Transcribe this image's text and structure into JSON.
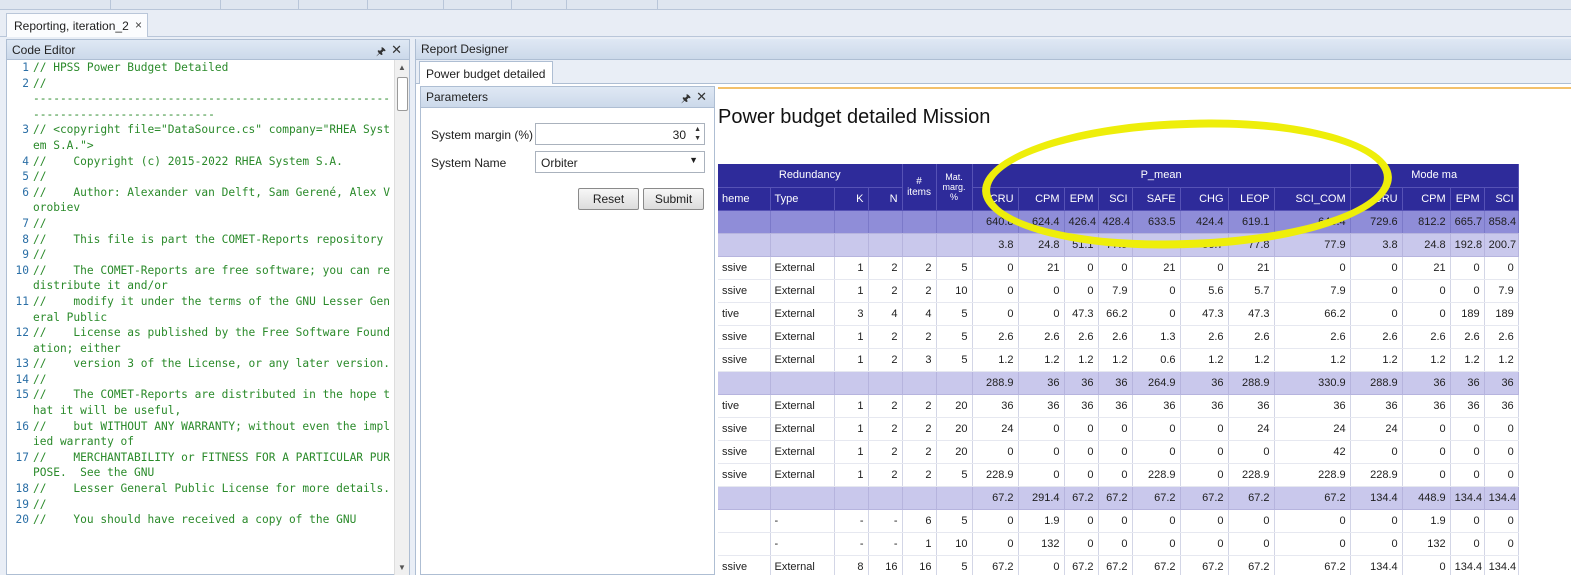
{
  "document_tab": {
    "title": "Reporting, iteration_2",
    "close": "×"
  },
  "code_editor": {
    "title": "Code Editor",
    "pin": "🖈",
    "close": "✕",
    "lines": [
      {
        "num": "1",
        "text": "// HPSS Power Budget Detailed"
      },
      {
        "num": "2",
        "text": "//"
      },
      {
        "num": "",
        "text": "--------------------------------------------------------------------------------"
      },
      {
        "num": "3",
        "text": "// <copyright file=\"DataSource.cs\" company=\"RHEA System S.A.\">"
      },
      {
        "num": "4",
        "text": "//    Copyright (c) 2015-2022 RHEA System S.A."
      },
      {
        "num": "5",
        "text": "//"
      },
      {
        "num": "6",
        "text": "//    Author: Alexander van Delft, Sam Gerené, Alex Vorobiev"
      },
      {
        "num": "7",
        "text": "//"
      },
      {
        "num": "8",
        "text": "//    This file is part the COMET-Reports repository"
      },
      {
        "num": "9",
        "text": "//"
      },
      {
        "num": "10",
        "text": "//    The COMET-Reports are free software; you can redistribute it and/or"
      },
      {
        "num": "11",
        "text": "//    modify it under the terms of the GNU Lesser General Public"
      },
      {
        "num": "12",
        "text": "//    License as published by the Free Software Foundation; either"
      },
      {
        "num": "13",
        "text": "//    version 3 of the License, or any later version."
      },
      {
        "num": "14",
        "text": "//"
      },
      {
        "num": "15",
        "text": "//    The COMET-Reports are distributed in the hope that it will be useful,"
      },
      {
        "num": "16",
        "text": "//    but WITHOUT ANY WARRANTY; without even the implied warranty of"
      },
      {
        "num": "17",
        "text": "//    MERCHANTABILITY or FITNESS FOR A PARTICULAR PURPOSE.  See the GNU"
      },
      {
        "num": "18",
        "text": "//    Lesser General Public License for more details."
      },
      {
        "num": "19",
        "text": "//"
      },
      {
        "num": "20",
        "text": "//    You should have received a copy of the GNU"
      }
    ]
  },
  "report_designer": {
    "title": "Report Designer",
    "tab": "Power budget detailed",
    "report_title": "Power budget detailed Mission"
  },
  "parameters": {
    "title": "Parameters",
    "pin": "🖈",
    "close": "✕",
    "system_margin_label": "System margin (%)",
    "system_margin_value": "30",
    "system_name_label": "System Name",
    "system_name_value": "Orbiter",
    "reset_label": "Reset",
    "submit_label": "Submit"
  },
  "table": {
    "group_redundancy": "Redundancy",
    "group_items": "#\nitems",
    "group_matmarg": "Mat.\nmarg.\n%",
    "group_pmean": "P_mean",
    "group_mode": "Mode ma",
    "headers": [
      "heme",
      "Type",
      "K",
      "N",
      "",
      "",
      "CRU",
      "CPM",
      "EPM",
      "SCI",
      "SAFE",
      "CHG",
      "LEOP",
      "SCI_COM",
      "CRU",
      "CPM",
      "EPM",
      "SCI"
    ],
    "rows": [
      {
        "kind": "sum1",
        "cells": [
          "",
          "",
          "",
          "",
          "",
          "",
          "640.8",
          "624.4",
          "426.4",
          "428.4",
          "633.5",
          "424.4",
          "619.1",
          "646.4",
          "729.6",
          "812.2",
          "665.7",
          "858.4"
        ]
      },
      {
        "kind": "sum",
        "cells": [
          "",
          "",
          "",
          "",
          "",
          "",
          "3.8",
          "24.8",
          "51.1",
          "77.9",
          "22.9",
          "56.7",
          "77.8",
          "77.9",
          "3.8",
          "24.8",
          "192.8",
          "200.7"
        ]
      },
      {
        "kind": "row",
        "cells": [
          "ssive",
          "External",
          "1",
          "2",
          "2",
          "5",
          "0",
          "21",
          "0",
          "0",
          "21",
          "0",
          "21",
          "0",
          "0",
          "21",
          "0",
          "0"
        ]
      },
      {
        "kind": "row",
        "cells": [
          "ssive",
          "External",
          "1",
          "2",
          "2",
          "10",
          "0",
          "0",
          "0",
          "7.9",
          "0",
          "5.6",
          "5.7",
          "7.9",
          "0",
          "0",
          "0",
          "7.9"
        ]
      },
      {
        "kind": "row",
        "cells": [
          "tive",
          "External",
          "3",
          "4",
          "4",
          "5",
          "0",
          "0",
          "47.3",
          "66.2",
          "0",
          "47.3",
          "47.3",
          "66.2",
          "0",
          "0",
          "189",
          "189"
        ]
      },
      {
        "kind": "row",
        "cells": [
          "ssive",
          "External",
          "1",
          "2",
          "2",
          "5",
          "2.6",
          "2.6",
          "2.6",
          "2.6",
          "1.3",
          "2.6",
          "2.6",
          "2.6",
          "2.6",
          "2.6",
          "2.6",
          "2.6"
        ]
      },
      {
        "kind": "row",
        "cells": [
          "ssive",
          "External",
          "1",
          "2",
          "3",
          "5",
          "1.2",
          "1.2",
          "1.2",
          "1.2",
          "0.6",
          "1.2",
          "1.2",
          "1.2",
          "1.2",
          "1.2",
          "1.2",
          "1.2"
        ]
      },
      {
        "kind": "sum",
        "cells": [
          "",
          "",
          "",
          "",
          "",
          "",
          "288.9",
          "36",
          "36",
          "36",
          "264.9",
          "36",
          "288.9",
          "330.9",
          "288.9",
          "36",
          "36",
          "36"
        ]
      },
      {
        "kind": "row",
        "cells": [
          "tive",
          "External",
          "1",
          "2",
          "2",
          "20",
          "36",
          "36",
          "36",
          "36",
          "36",
          "36",
          "36",
          "36",
          "36",
          "36",
          "36",
          "36"
        ]
      },
      {
        "kind": "row",
        "cells": [
          "ssive",
          "External",
          "1",
          "2",
          "2",
          "20",
          "24",
          "0",
          "0",
          "0",
          "0",
          "0",
          "24",
          "24",
          "24",
          "0",
          "0",
          "0"
        ]
      },
      {
        "kind": "row",
        "cells": [
          "ssive",
          "External",
          "1",
          "2",
          "2",
          "20",
          "0",
          "0",
          "0",
          "0",
          "0",
          "0",
          "0",
          "42",
          "0",
          "0",
          "0",
          "0"
        ]
      },
      {
        "kind": "row",
        "cells": [
          "ssive",
          "External",
          "1",
          "2",
          "2",
          "5",
          "228.9",
          "0",
          "0",
          "0",
          "228.9",
          "0",
          "228.9",
          "228.9",
          "228.9",
          "0",
          "0",
          "0"
        ]
      },
      {
        "kind": "sum",
        "cells": [
          "",
          "",
          "",
          "",
          "",
          "",
          "67.2",
          "291.4",
          "67.2",
          "67.2",
          "67.2",
          "67.2",
          "67.2",
          "67.2",
          "134.4",
          "448.9",
          "134.4",
          "134.4"
        ]
      },
      {
        "kind": "row",
        "cells": [
          "",
          "-",
          "-",
          "-",
          "6",
          "5",
          "0",
          "1.9",
          "0",
          "0",
          "0",
          "0",
          "0",
          "0",
          "0",
          "1.9",
          "0",
          "0"
        ]
      },
      {
        "kind": "row",
        "cells": [
          "",
          "-",
          "-",
          "-",
          "1",
          "10",
          "0",
          "132",
          "0",
          "0",
          "0",
          "0",
          "0",
          "0",
          "0",
          "132",
          "0",
          "0"
        ]
      },
      {
        "kind": "row",
        "cells": [
          "ssive",
          "External",
          "8",
          "16",
          "16",
          "5",
          "67.2",
          "0",
          "67.2",
          "67.2",
          "67.2",
          "67.2",
          "67.2",
          "67.2",
          "134.4",
          "0",
          "134.4",
          "134.4"
        ]
      }
    ]
  },
  "colors": {
    "header": "#2e2b9a",
    "sum_row": "#c9c8ec",
    "total_row": "#8f8dd8",
    "highlight": "#eeee0a",
    "code": "#2a8a2a"
  }
}
